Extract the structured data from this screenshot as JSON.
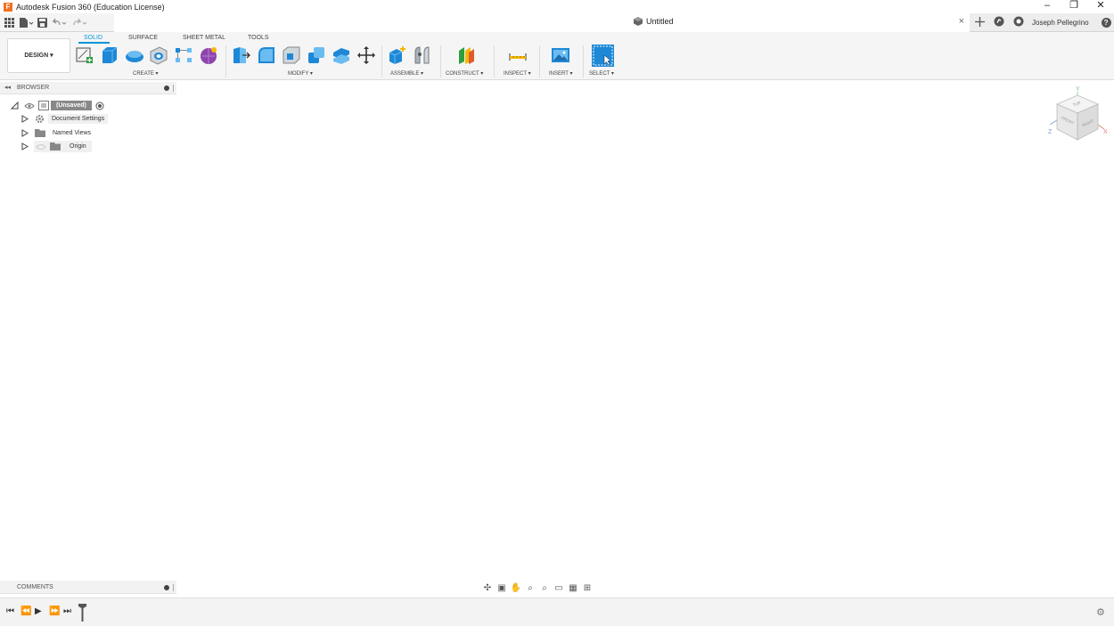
{
  "app": {
    "title": "Autodesk Fusion 360 (Education License)",
    "logo_letter": "F",
    "window_controls": [
      "–",
      "❐",
      "✕"
    ]
  },
  "quick_access": {
    "icons": [
      "apps-grid-icon",
      "file-icon",
      "save-icon",
      "undo-icon",
      "redo-icon"
    ]
  },
  "document": {
    "title": "Untitled",
    "close_glyph": "×"
  },
  "header_right": {
    "user_name": "Joseph Pellegrino",
    "help_glyph": "?"
  },
  "ribbon": {
    "workspace": "DESIGN ▾",
    "tabs": [
      "SOLID",
      "SURFACE",
      "SHEET METAL",
      "TOOLS"
    ],
    "active_tab": "SOLID",
    "groups": [
      "CREATE ▾",
      "MODIFY ▾",
      "ASSEMBLE ▾",
      "CONSTRUCT ▾",
      "INSPECT ▾",
      "INSERT ▾",
      "SELECT ▾"
    ]
  },
  "browser": {
    "title": "BROWSER",
    "root": "(Unsaved)",
    "items": [
      "Document Settings",
      "Named Views",
      "Origin"
    ]
  },
  "comments": {
    "title": "COMMENTS"
  },
  "viewcube": {
    "faces": [
      "TOP",
      "FRONT",
      "RIGHT"
    ],
    "axes": [
      "Y",
      "Z",
      "X"
    ]
  },
  "colors": {
    "accent": "#0696d7",
    "select_blue": "#1e88d6",
    "ribbon_bg": "#f5f5f5"
  }
}
